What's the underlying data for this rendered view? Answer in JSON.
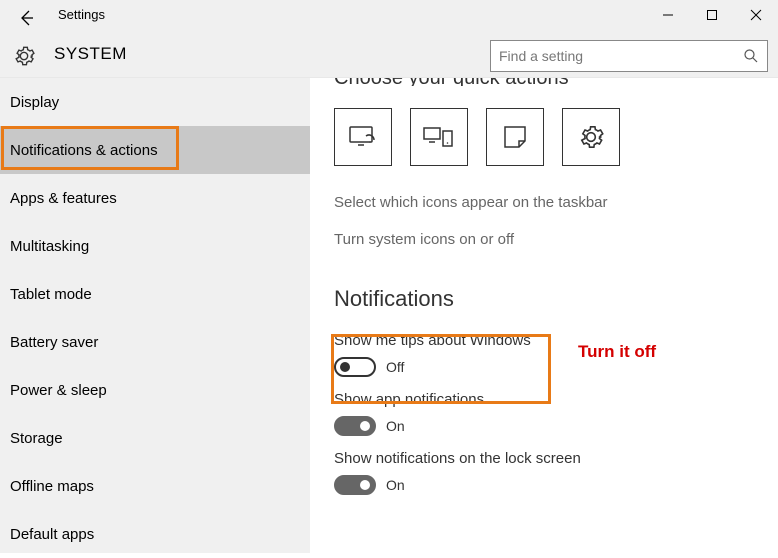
{
  "window": {
    "title": "Settings"
  },
  "page": {
    "header": "SYSTEM",
    "search_placeholder": "Find a setting"
  },
  "sidebar": {
    "items": [
      "Display",
      "Notifications & actions",
      "Apps & features",
      "Multitasking",
      "Tablet mode",
      "Battery saver",
      "Power & sleep",
      "Storage",
      "Offline maps",
      "Default apps"
    ],
    "selected_index": 1
  },
  "content": {
    "clipped_heading": "Choose your quick actions",
    "quick_actions": [
      {
        "icon": "tablet-mode"
      },
      {
        "icon": "connect"
      },
      {
        "icon": "note"
      },
      {
        "icon": "settings"
      }
    ],
    "links": [
      "Select which icons appear on the taskbar",
      "Turn system icons on or off"
    ],
    "section_heading": "Notifications",
    "toggles": [
      {
        "label": "Show me tips about Windows",
        "on": false,
        "state": "Off"
      },
      {
        "label": "Show app notifications",
        "on": true,
        "state": "On"
      },
      {
        "label": "Show notifications on the lock screen",
        "on": true,
        "state": "On"
      }
    ]
  },
  "annotations": {
    "callout_text": "Turn it off"
  }
}
